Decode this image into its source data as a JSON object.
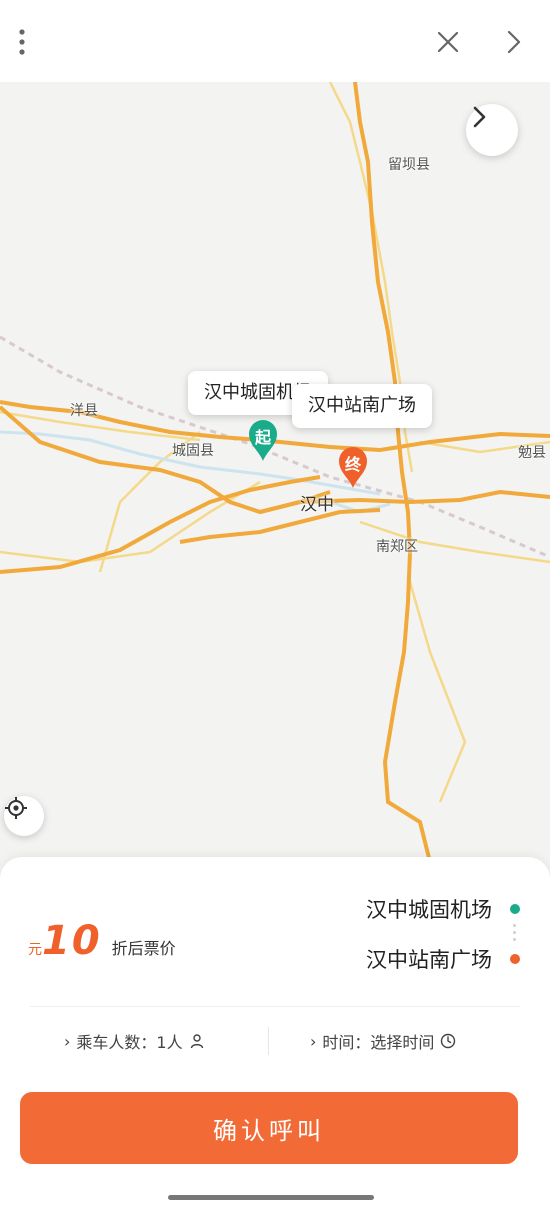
{
  "map": {
    "labels": {
      "liuba": "留坝县",
      "yangxian": "洋县",
      "chenggu": "城固县",
      "hanzhong": "汉中",
      "nanzheng": "南郑区",
      "mianxian": "勉县"
    },
    "callout_origin": "汉中城固机场",
    "callout_destination": "汉中站南广场",
    "pin_origin": "起",
    "pin_destination": "终"
  },
  "route": {
    "origin": "汉中城固机场",
    "destination": "汉中站南广场",
    "origin_color": "#1aab8a",
    "destination_color": "#f0602a"
  },
  "fare": {
    "label": "折后票价",
    "value": "10",
    "unit": "元"
  },
  "options": {
    "time_label": "时间：选择时间",
    "passengers_label": "乘车人数：1人"
  },
  "actions": {
    "confirm_label": "确认呼叫"
  },
  "icons": {
    "menu": "more-vertical-icon",
    "close": "close-icon",
    "forward": "chevron-right-icon",
    "expand": "chevron-right-icon",
    "locate": "locate-icon",
    "clock": "clock-icon",
    "person": "person-icon"
  },
  "colors": {
    "accent": "#f26a35",
    "origin_pin": "#1aab8a",
    "destination_pin": "#f0602a",
    "road": "#f0a93a"
  }
}
